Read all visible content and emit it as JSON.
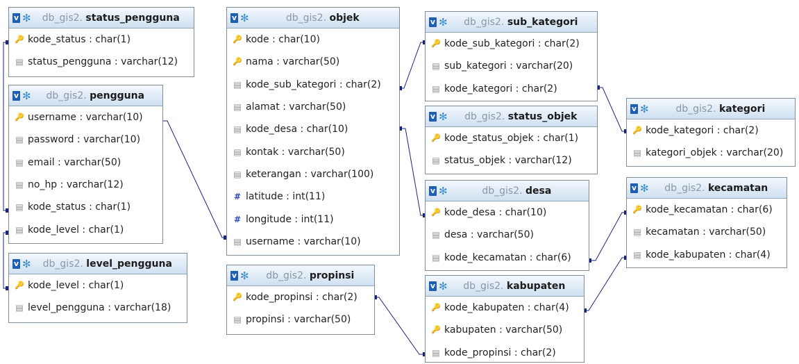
{
  "tables": [
    {
      "id": "status_pengguna",
      "db": "db_gis2.",
      "name": "status_pengguna",
      "columns": [
        {
          "text": "kode_status : char(1)",
          "icon": "key"
        },
        {
          "text": "status_pengguna : varchar(12)",
          "icon": "column"
        }
      ]
    },
    {
      "id": "pengguna",
      "db": "db_gis2.",
      "name": "pengguna",
      "columns": [
        {
          "text": "username : varchar(10)",
          "icon": "key"
        },
        {
          "text": "password : varchar(10)",
          "icon": "column"
        },
        {
          "text": "email : varchar(50)",
          "icon": "column"
        },
        {
          "text": "no_hp : varchar(12)",
          "icon": "column"
        },
        {
          "text": "kode_status : char(1)",
          "icon": "column"
        },
        {
          "text": "kode_level : char(1)",
          "icon": "column"
        }
      ]
    },
    {
      "id": "level_pengguna",
      "db": "db_gis2.",
      "name": "level_pengguna",
      "columns": [
        {
          "text": "kode_level : char(1)",
          "icon": "key"
        },
        {
          "text": "level_pengguna : varchar(18)",
          "icon": "column"
        }
      ]
    },
    {
      "id": "objek",
      "db": "db_gis2.",
      "name": "objek",
      "columns": [
        {
          "text": "kode : char(10)",
          "icon": "key"
        },
        {
          "text": "nama : varchar(50)",
          "icon": "key"
        },
        {
          "text": "kode_sub_kategori : char(2)",
          "icon": "column"
        },
        {
          "text": "alamat : varchar(50)",
          "icon": "column"
        },
        {
          "text": "kode_desa : char(10)",
          "icon": "column"
        },
        {
          "text": "kontak : varchar(50)",
          "icon": "column"
        },
        {
          "text": "keterangan : varchar(100)",
          "icon": "column"
        },
        {
          "text": "latitude : int(11)",
          "icon": "numeric"
        },
        {
          "text": "longitude : int(11)",
          "icon": "numeric"
        },
        {
          "text": "username : varchar(10)",
          "icon": "column"
        }
      ]
    },
    {
      "id": "propinsi",
      "db": "db_gis2.",
      "name": "propinsi",
      "columns": [
        {
          "text": "kode_propinsi : char(2)",
          "icon": "key"
        },
        {
          "text": "propinsi : varchar(50)",
          "icon": "column"
        }
      ]
    },
    {
      "id": "sub_kategori",
      "db": "db_gis2.",
      "name": "sub_kategori",
      "columns": [
        {
          "text": "kode_sub_kategori : char(2)",
          "icon": "key"
        },
        {
          "text": "sub_kategori : varchar(20)",
          "icon": "column"
        },
        {
          "text": "kode_kategori : char(2)",
          "icon": "column"
        }
      ]
    },
    {
      "id": "status_objek",
      "db": "db_gis2.",
      "name": "status_objek",
      "columns": [
        {
          "text": "kode_status_objek : char(1)",
          "icon": "key"
        },
        {
          "text": "status_objek : varchar(12)",
          "icon": "column"
        }
      ]
    },
    {
      "id": "desa",
      "db": "db_gis2.",
      "name": "desa",
      "columns": [
        {
          "text": "kode_desa : char(10)",
          "icon": "key"
        },
        {
          "text": "desa : varchar(50)",
          "icon": "column"
        },
        {
          "text": "kode_kecamatan : char(6)",
          "icon": "column"
        }
      ]
    },
    {
      "id": "kabupaten",
      "db": "db_gis2.",
      "name": "kabupaten",
      "columns": [
        {
          "text": "kode_kabupaten : char(4)",
          "icon": "key"
        },
        {
          "text": "kabupaten : varchar(50)",
          "icon": "key"
        },
        {
          "text": "kode_propinsi : char(2)",
          "icon": "column"
        }
      ]
    },
    {
      "id": "kategori",
      "db": "db_gis2.",
      "name": "kategori",
      "columns": [
        {
          "text": "kode_kategori : char(2)",
          "icon": "key"
        },
        {
          "text": "kategori_objek : varchar(20)",
          "icon": "column"
        }
      ]
    },
    {
      "id": "kecamatan",
      "db": "db_gis2.",
      "name": "kecamatan",
      "columns": [
        {
          "text": "kode_kecamatan : char(6)",
          "icon": "key"
        },
        {
          "text": "kecamatan : varchar(50)",
          "icon": "column"
        },
        {
          "text": "kode_kabupaten : char(4)",
          "icon": "column"
        }
      ]
    }
  ],
  "relations": [
    {
      "from": "pengguna.kode_status",
      "to": "status_pengguna.kode_status"
    },
    {
      "from": "pengguna.kode_level",
      "to": "level_pengguna.kode_level"
    },
    {
      "from": "objek.username",
      "to": "pengguna.username"
    },
    {
      "from": "objek.kode_sub_kategori",
      "to": "sub_kategori.kode_sub_kategori"
    },
    {
      "from": "objek.kode_desa",
      "to": "desa.kode_desa"
    },
    {
      "from": "sub_kategori.kode_kategori",
      "to": "kategori.kode_kategori"
    },
    {
      "from": "desa.kode_kecamatan",
      "to": "kecamatan.kode_kecamatan"
    },
    {
      "from": "kecamatan.kode_kabupaten",
      "to": "kabupaten.kode_kabupaten"
    },
    {
      "from": "kabupaten.kode_propinsi",
      "to": "propinsi.kode_propinsi"
    }
  ],
  "colors": {
    "header_top": "#f3f8fd",
    "header_bottom": "#cfe0f1",
    "border": "#7f8c9a",
    "line": "#1a237e"
  },
  "icons": {
    "header": [
      "v-icon",
      "gear-icon"
    ],
    "key": "key-icon",
    "column": "column-icon",
    "numeric": "hash-icon"
  }
}
